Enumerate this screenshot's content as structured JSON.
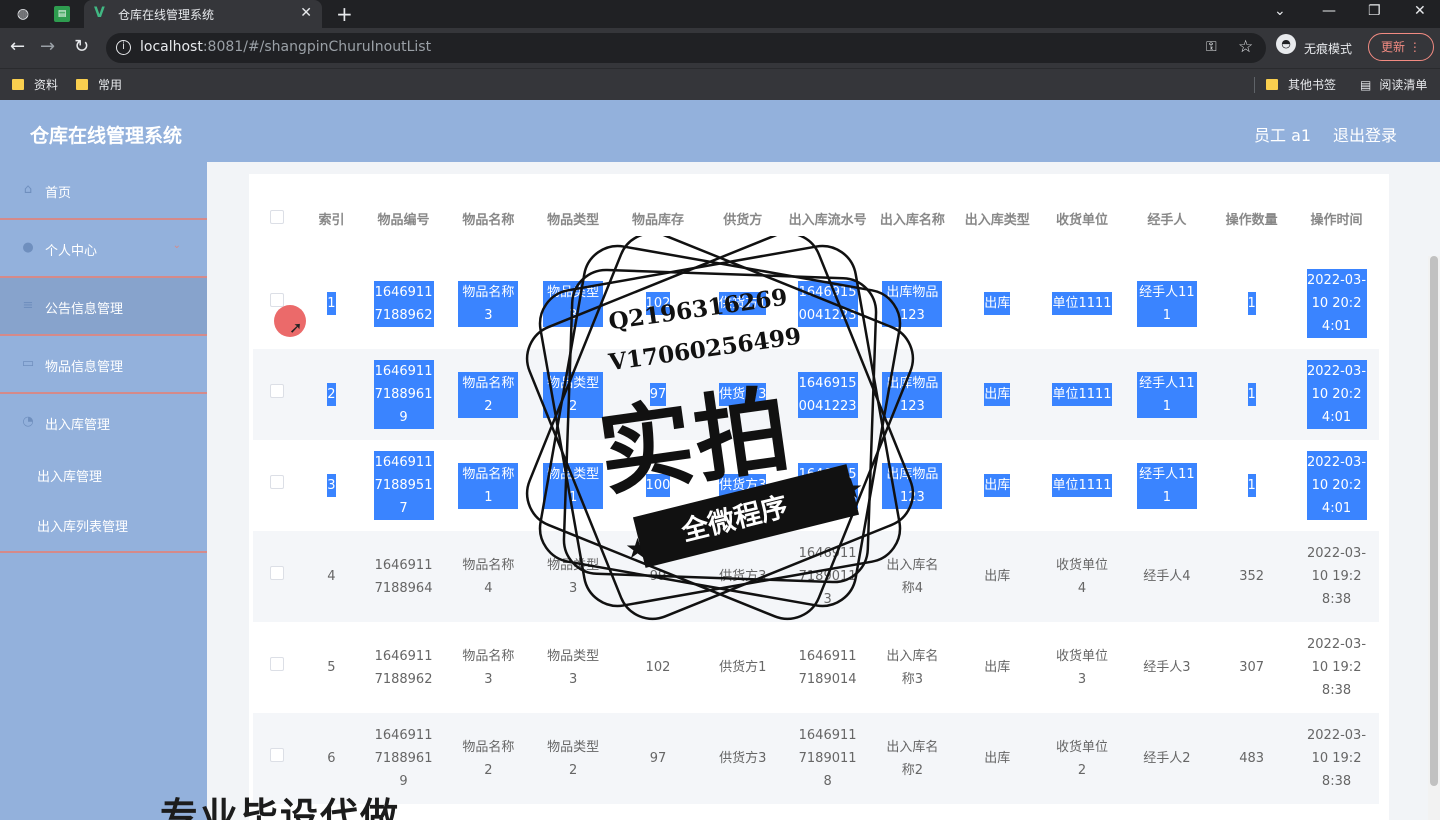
{
  "browser": {
    "tab_title": "仓库在线管理系统",
    "url_host": "localhost",
    "url_rest": ":8081/#/shangpinChuruInoutList",
    "incognito_label": "无痕模式",
    "update_label": "更新",
    "bookmarks": [
      "资料",
      "常用"
    ],
    "bookmarks_right": [
      "其他书签",
      "阅读清单"
    ]
  },
  "header": {
    "title": "仓库在线管理系统",
    "user": "员工 a1",
    "logout": "退出登录"
  },
  "sidebar": {
    "items": [
      {
        "label": "首页",
        "icon": "home-icon"
      },
      {
        "label": "个人中心",
        "icon": "user-icon"
      },
      {
        "label": "公告信息管理",
        "icon": "notice-icon"
      },
      {
        "label": "物品信息管理",
        "icon": "goods-icon"
      },
      {
        "label": "出入库管理",
        "icon": "inout-icon"
      }
    ],
    "sub_items": [
      "出入库管理",
      "出入库列表管理"
    ]
  },
  "table": {
    "columns": [
      "索引",
      "物品编号",
      "物品名称",
      "物品类型",
      "物品库存",
      "供货方",
      "出入库流水号",
      "出入库名称",
      "出入库类型",
      "收货单位",
      "经手人",
      "操作数量",
      "操作时间"
    ],
    "rows": [
      [
        "1",
        "16469117188962",
        "物品名称3",
        "物品类型3",
        "102",
        "供货方1",
        "16469150041223",
        "出库物品123",
        "出库",
        "单位1111",
        "经手人111",
        "1",
        "2022-03-10 20:24:01"
      ],
      [
        "2",
        "16469117188961 9",
        "物品名称2",
        "物品类型2",
        "97",
        "供货方3",
        "16469150041223",
        "出库物品123",
        "出库",
        "单位1111",
        "经手人111",
        "1",
        "2022-03-10 20:24:01"
      ],
      [
        "3",
        "16469117188951 7",
        "物品名称1",
        "物品类型1",
        "100",
        "供货方3",
        "16469150041223",
        "出库物品123",
        "出库",
        "单位1111",
        "经手人111",
        "1",
        "2022-03-10 20:24:01"
      ],
      [
        "4",
        "16469117188964",
        "物品名称4",
        "物品类型3",
        "99",
        "供货方3",
        "16469117189011 3",
        "出入库名称4",
        "出库",
        "收货单位4",
        "经手人4",
        "352",
        "2022-03-10 19:28:38"
      ],
      [
        "5",
        "16469117188962",
        "物品名称3",
        "物品类型3",
        "102",
        "供货方1",
        "16469117189014",
        "出入库名称3",
        "出库",
        "收货单位3",
        "经手人3",
        "307",
        "2022-03-10 19:28:38"
      ],
      [
        "6",
        "16469117188961 9",
        "物品名称2",
        "物品类型2",
        "97",
        "供货方3",
        "16469117189011 8",
        "出入库名称2",
        "出库",
        "收货单位2",
        "经手人2",
        "483",
        "2022-03-10 19:28:38"
      ]
    ]
  },
  "overlay": {
    "stamp_q": "Q2196316269",
    "stamp_v": "V17060256499",
    "stamp_big": "实拍",
    "stamp_banner": "全微程序",
    "caption": "专业毕设代做"
  }
}
